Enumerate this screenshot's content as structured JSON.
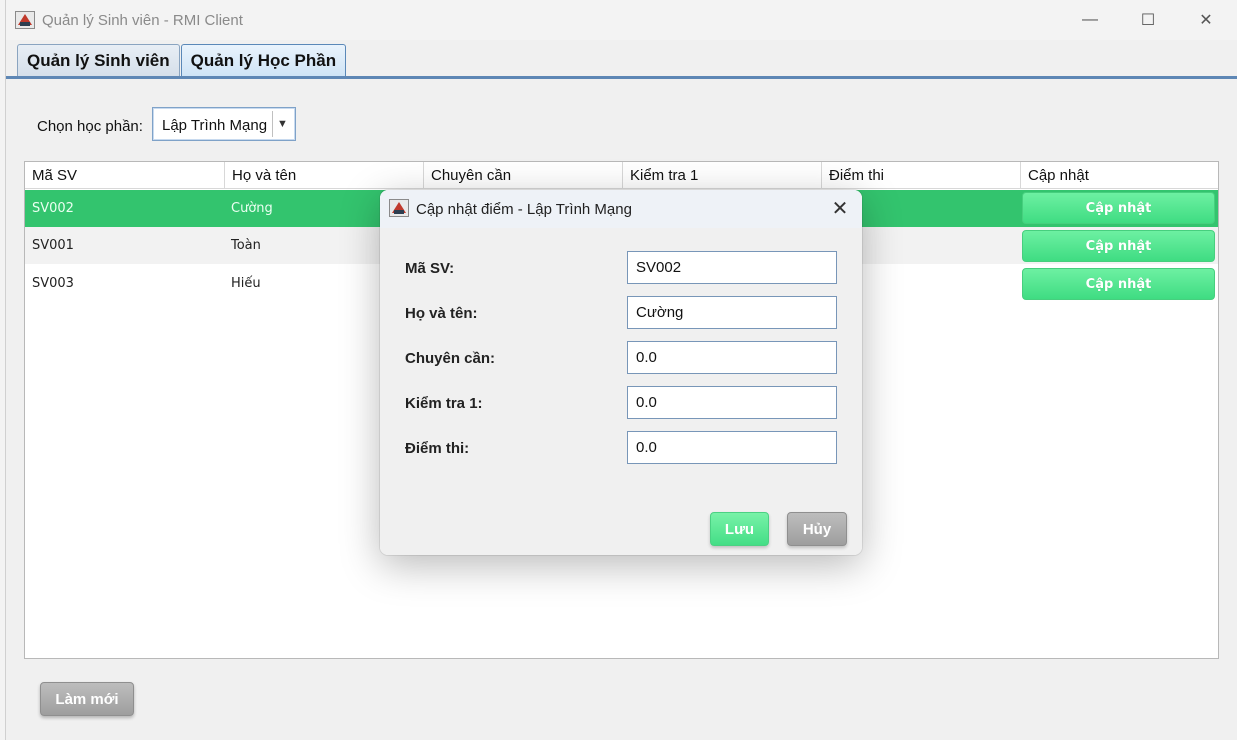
{
  "window": {
    "title": "Quản lý Sinh viên - RMI Client",
    "min_glyph": "—",
    "max_glyph": "☐",
    "close_glyph": "✕"
  },
  "tabs": [
    {
      "label": "Quản lý Sinh viên",
      "active": false
    },
    {
      "label": "Quản lý Học Phần",
      "active": true
    }
  ],
  "chooser": {
    "label": "Chọn học phần:",
    "selected": "Lập Trình Mạng",
    "arrow_glyph": "▼"
  },
  "table": {
    "columns": [
      "Mã SV",
      "Họ và tên",
      "Chuyên cần",
      "Kiểm tra 1",
      "Điểm thi",
      "Cập nhật"
    ],
    "rows": [
      {
        "id": "SV002",
        "name": "Cường",
        "action": "Cập nhật",
        "selected": true
      },
      {
        "id": "SV001",
        "name": "Toàn",
        "action": "Cập nhật",
        "selected": false
      },
      {
        "id": "SV003",
        "name": "Hiếu",
        "action": "Cập nhật",
        "selected": false
      }
    ]
  },
  "refresh_label": "Làm mới",
  "dialog": {
    "title": "Cập nhật điểm - Lập Trình Mạng",
    "close_glyph": "✕",
    "fields": [
      {
        "label": "Mã SV:",
        "value": "SV002"
      },
      {
        "label": "Họ và tên:",
        "value": "Cường"
      },
      {
        "label": "Chuyên cần:",
        "value": "0.0"
      },
      {
        "label": "Kiểm tra 1:",
        "value": "0.0"
      },
      {
        "label": "Điểm thi:",
        "value": "0.0"
      }
    ],
    "save_label": "Lưu",
    "cancel_label": "Hủy"
  },
  "colors": {
    "selected_row": "#33c46e",
    "action_button": "#44de86",
    "neutral_button": "#a8a8a8",
    "tab_accent": "#5e87b5"
  }
}
